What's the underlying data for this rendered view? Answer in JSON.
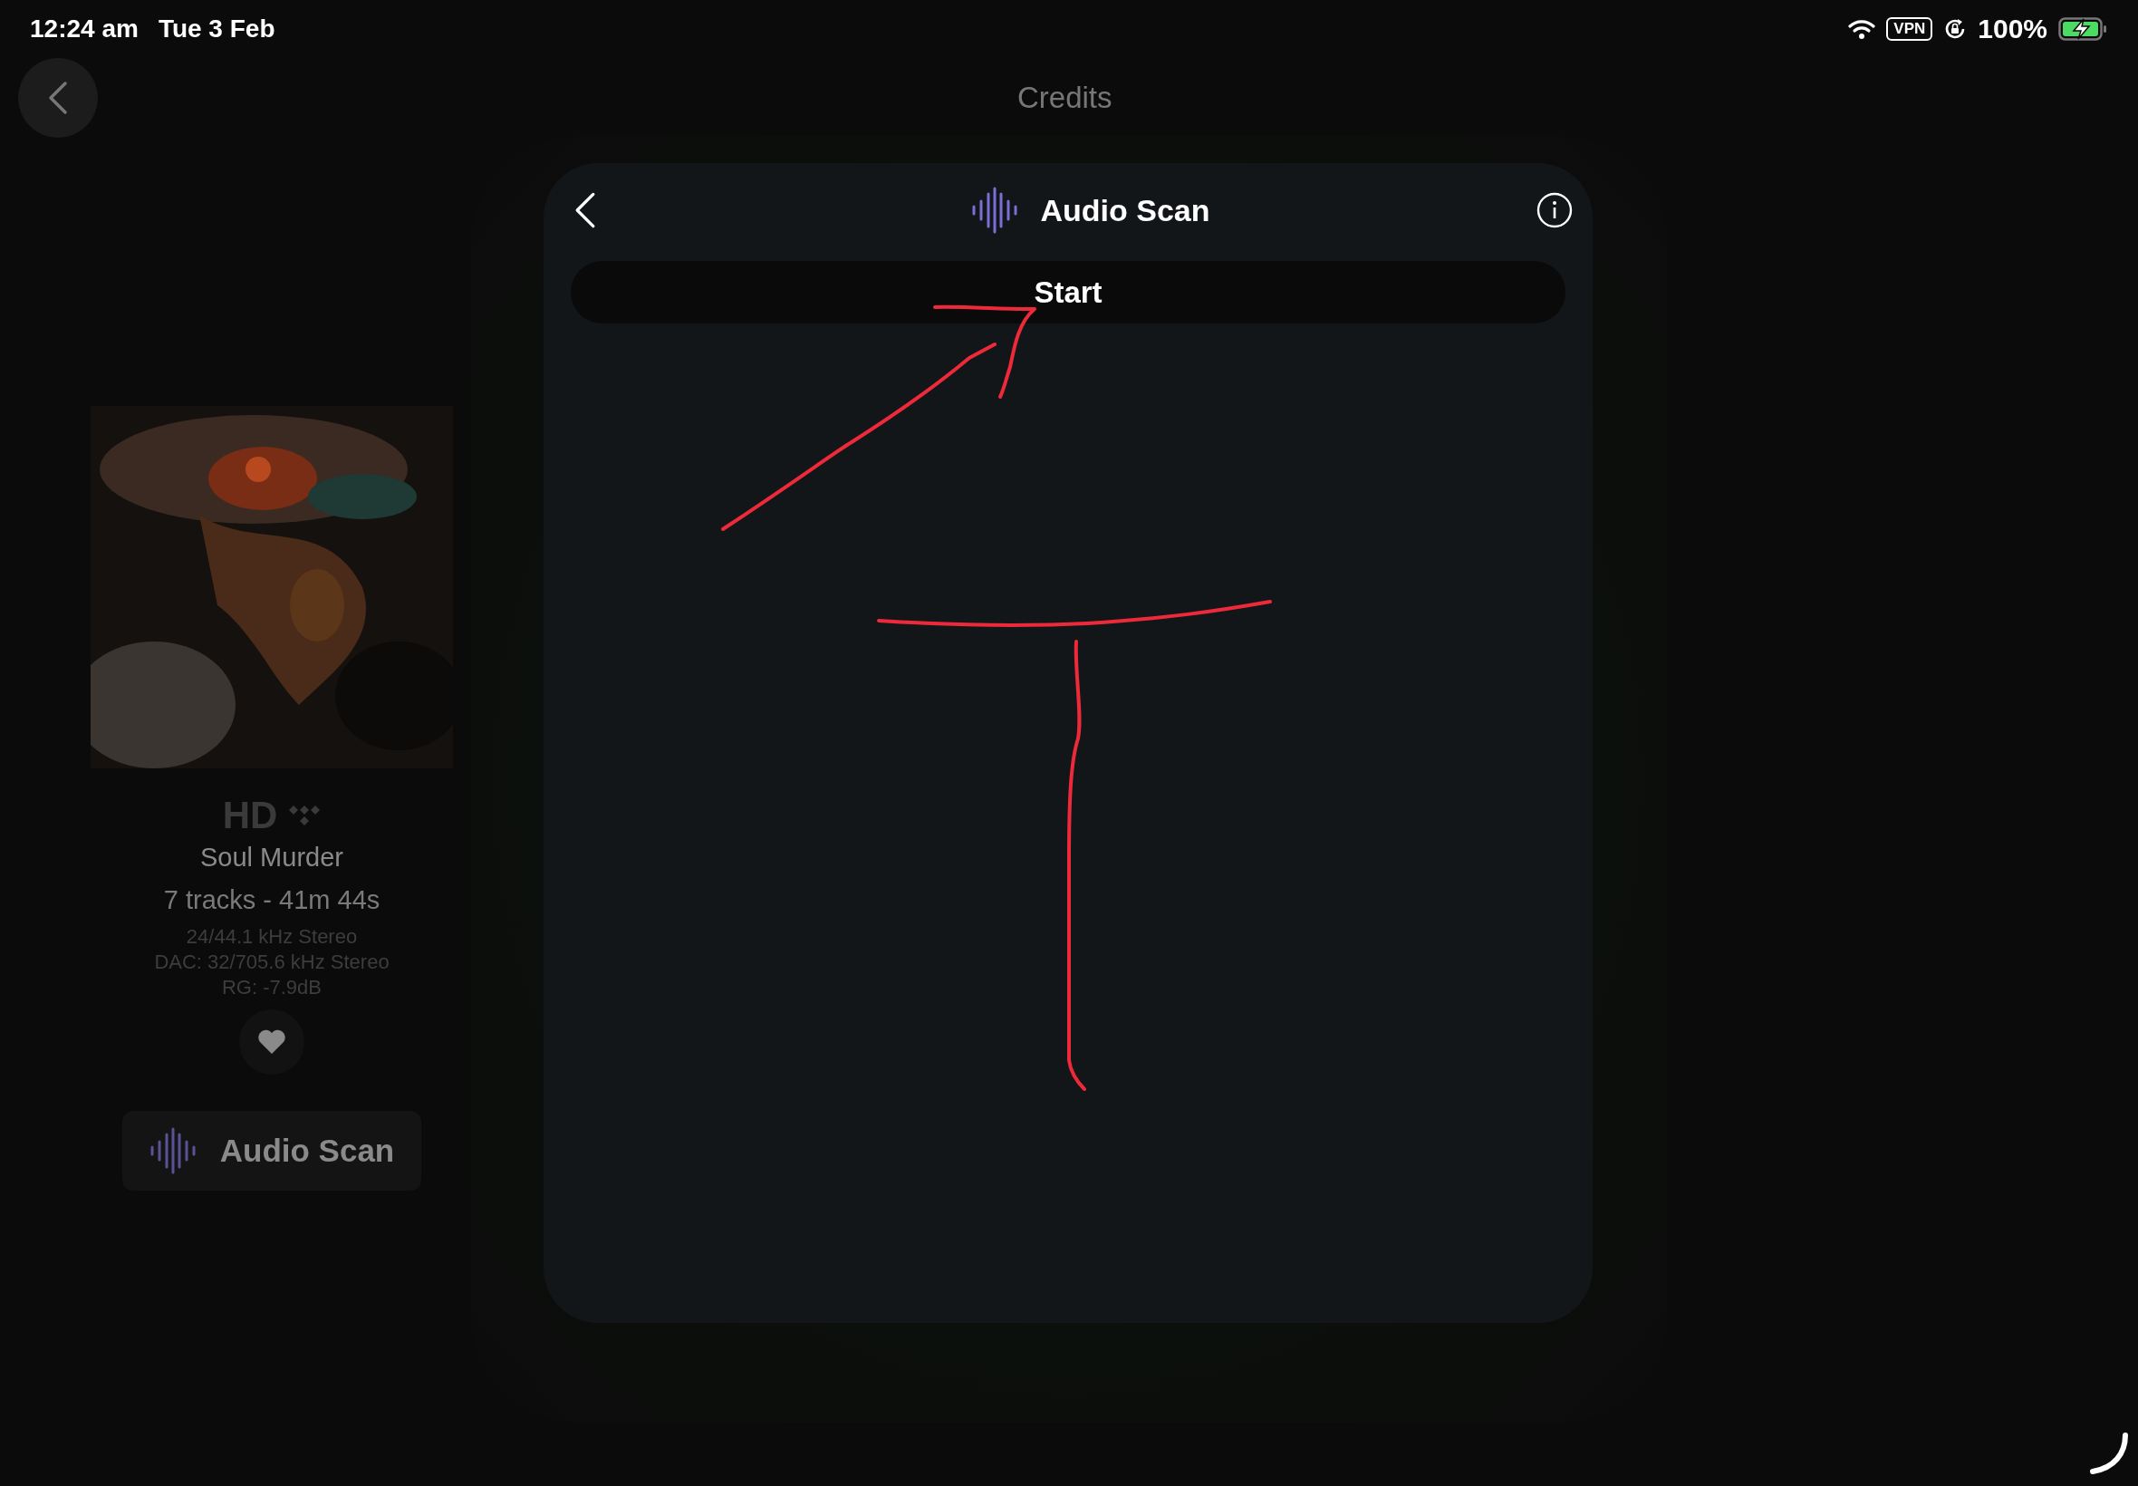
{
  "status_bar": {
    "time": "12:24 am",
    "date": "Tue 3 Feb",
    "vpn": "VPN",
    "battery": "100%"
  },
  "page": {
    "title": "Credits"
  },
  "album": {
    "quality": "HD",
    "title": "Soul Murder",
    "summary": "7 tracks - 41m 44s",
    "format": "24/44.1 kHz Stereo",
    "dac": "DAC: 32/705.6 kHz Stereo",
    "replay_gain": "RG: -7.9dB",
    "scan_button": "Audio Scan"
  },
  "modal": {
    "title": "Audio Scan",
    "start_button": "Start"
  }
}
